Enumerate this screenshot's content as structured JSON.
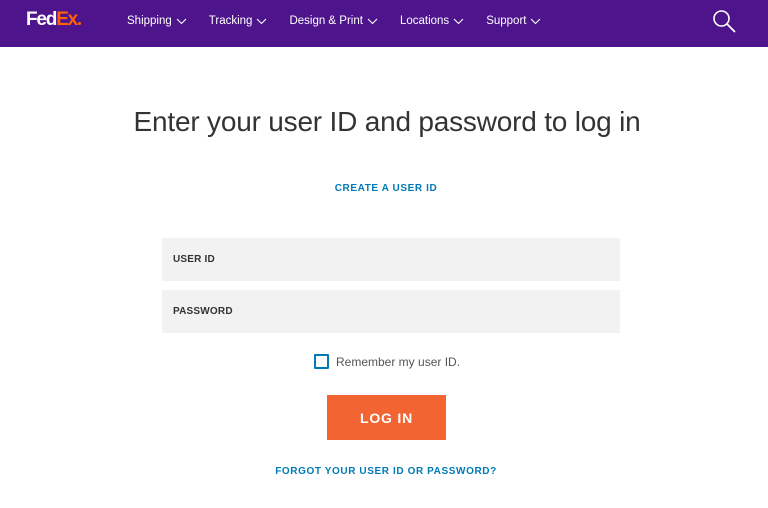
{
  "header": {
    "logo": {
      "fed": "Fed",
      "ex": "Ex"
    },
    "nav_items": [
      {
        "label": "Shipping"
      },
      {
        "label": "Tracking"
      },
      {
        "label": "Design & Print"
      },
      {
        "label": "Locations"
      },
      {
        "label": "Support"
      }
    ],
    "colors": {
      "background": "#4d148c",
      "logo_fed": "#ffffff",
      "logo_ex": "#ff6200"
    },
    "icons": [
      "chevron-down-icon",
      "search-icon"
    ]
  },
  "main": {
    "title": "Enter your user ID and password to log in",
    "create_link": "CREATE A USER ID",
    "fields": {
      "user_id": {
        "placeholder": "USER ID",
        "value": ""
      },
      "password": {
        "placeholder": "PASSWORD",
        "value": ""
      }
    },
    "remember": {
      "label": "Remember my user ID.",
      "checked": false
    },
    "login_button": "LOG IN",
    "forgot_link": "FORGOT YOUR USER ID OR PASSWORD?",
    "colors": {
      "link": "#007ab7",
      "button": "#f26431",
      "field_bg": "#f2f2f2"
    }
  }
}
